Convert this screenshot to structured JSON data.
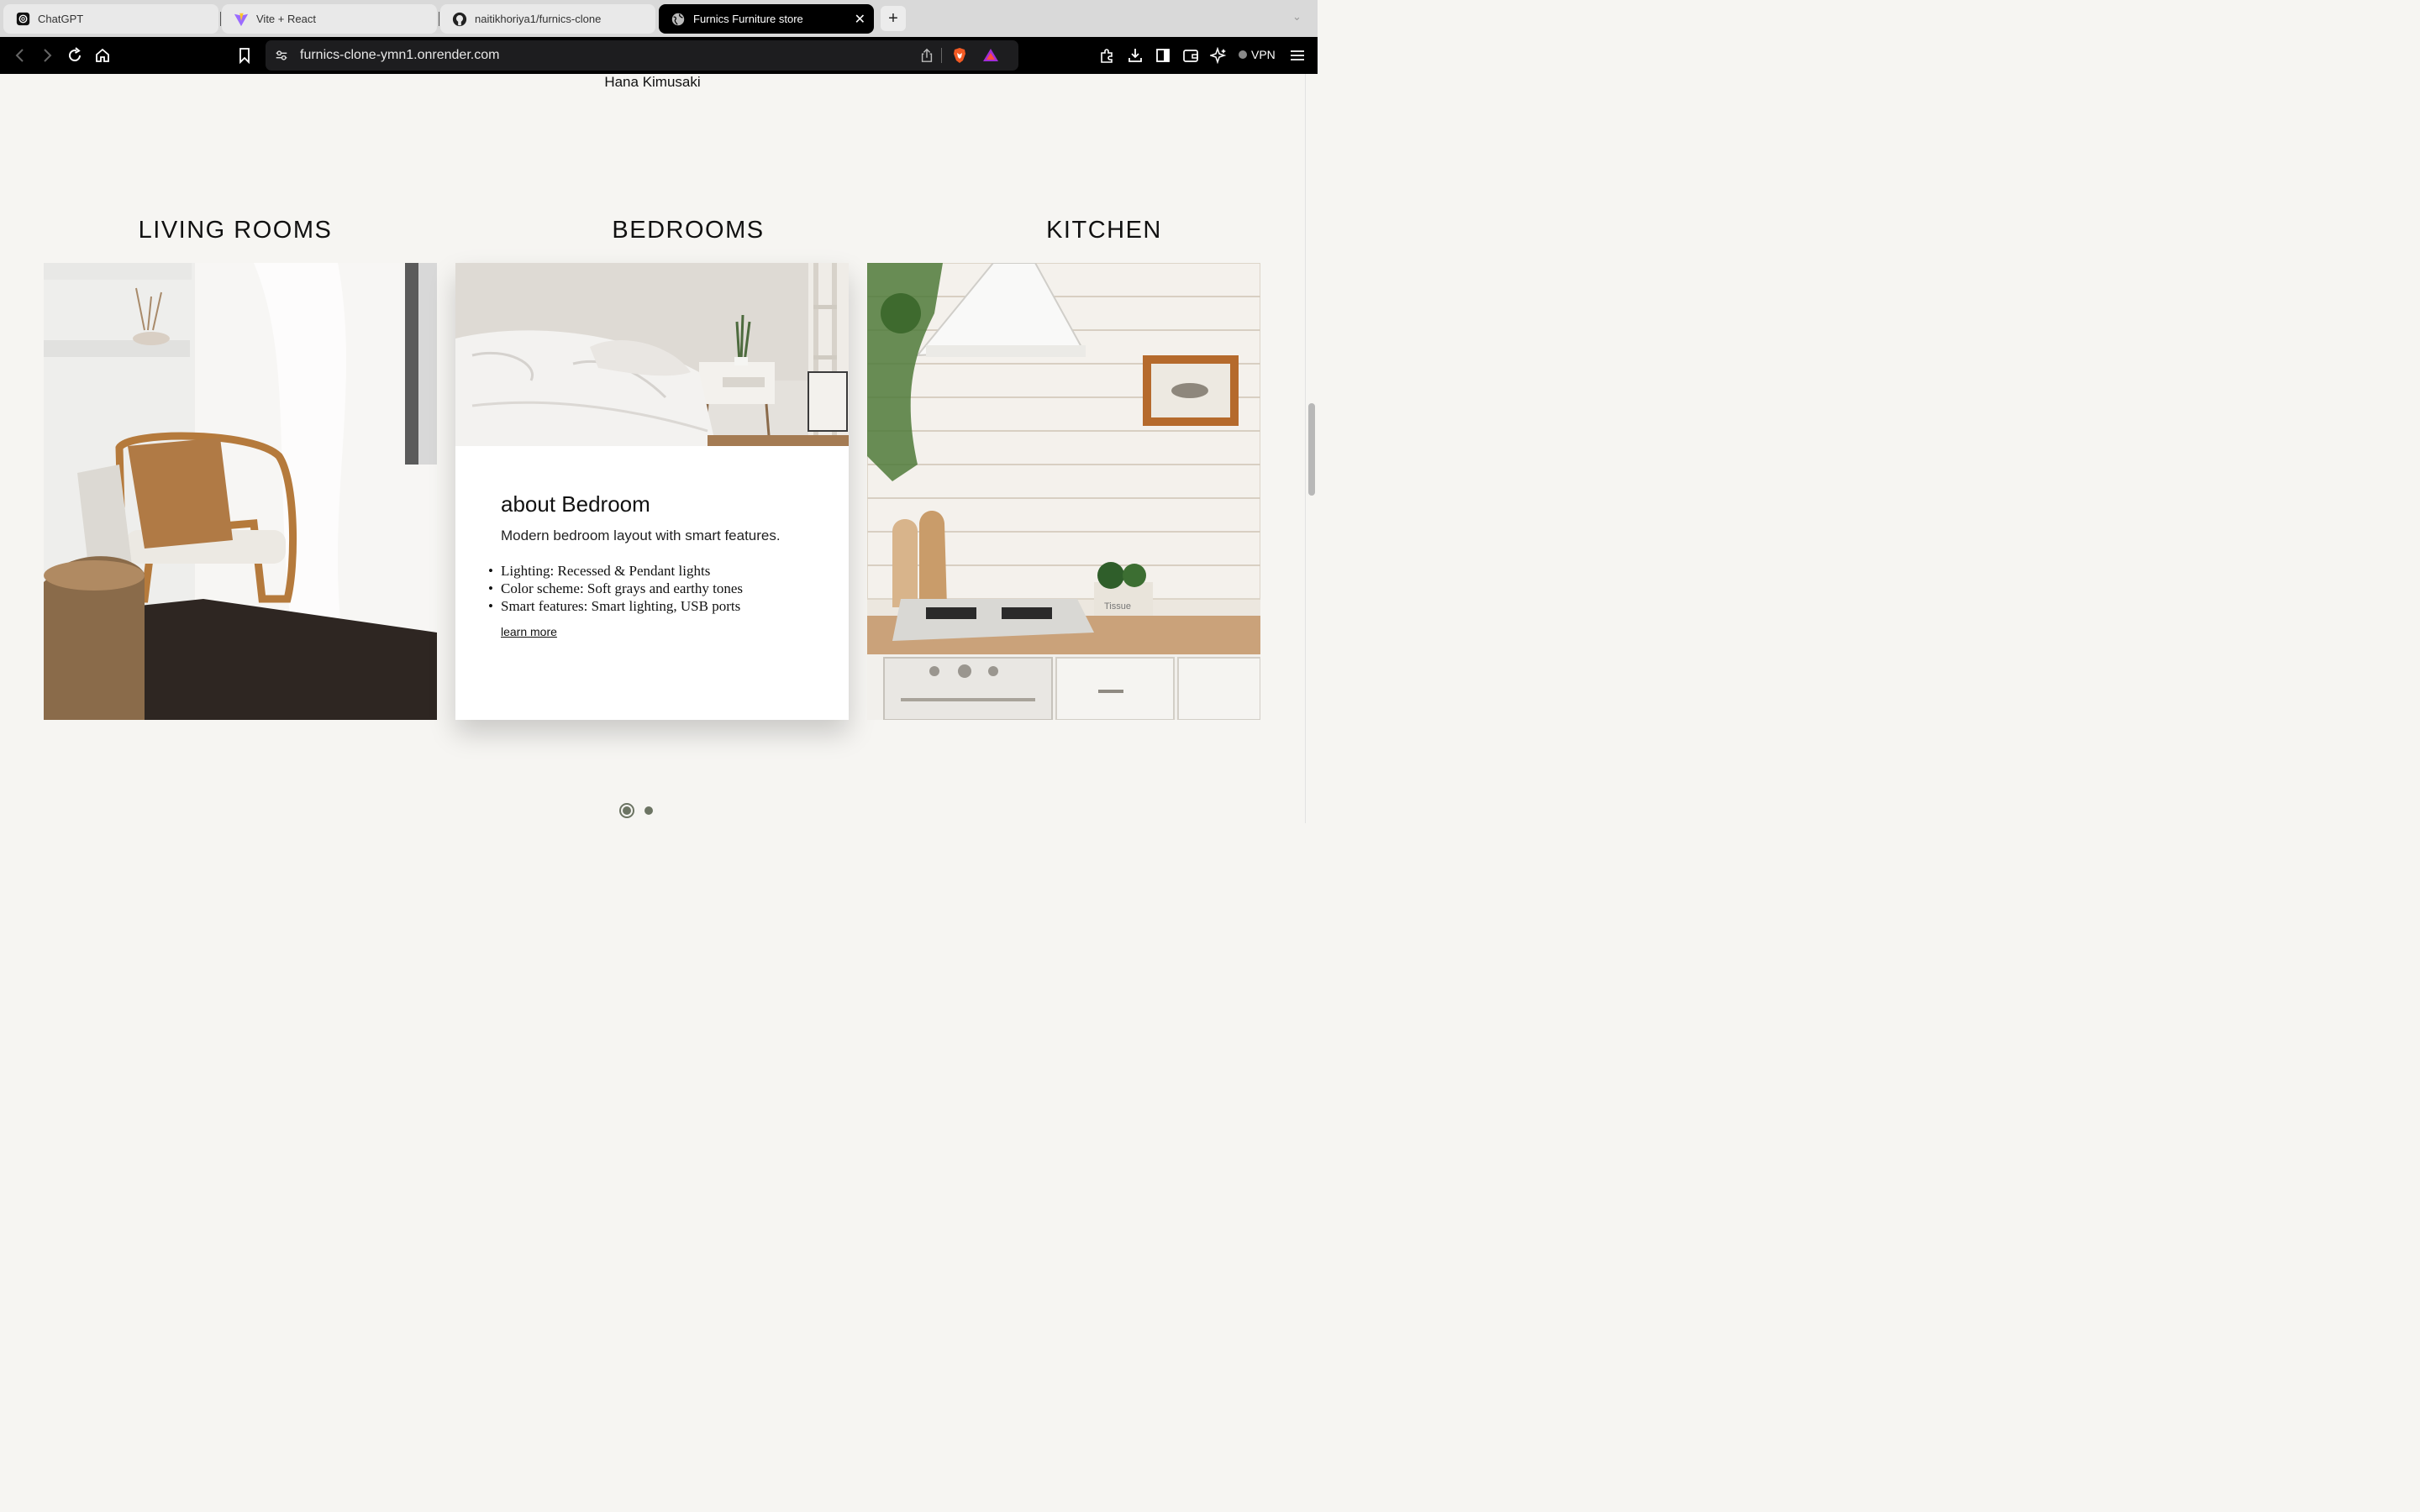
{
  "browser": {
    "tabs": [
      {
        "title": "ChatGPT",
        "icon": "chatgpt-icon"
      },
      {
        "title": "Vite + React",
        "icon": "vite-icon"
      },
      {
        "title": "naitikhoriya1/furnics-clone",
        "icon": "github-icon"
      },
      {
        "title": "Furnics Furniture store",
        "icon": "globe-icon",
        "active": true
      }
    ],
    "url": "furnics-clone-ymn1.onrender.com",
    "vpn_label": "VPN"
  },
  "page": {
    "author_name": "Hana Kimusaki",
    "categories": [
      {
        "title": "LIVING ROOMS"
      },
      {
        "title": "BEDROOMS"
      },
      {
        "title": "KITCHEN"
      }
    ],
    "bedroom_card": {
      "title": "about Bedroom",
      "description": "Modern bedroom layout with smart features.",
      "features": [
        "Lighting: Recessed & Pendant lights",
        "Color scheme: Soft grays and earthy tones",
        "Smart features: Smart lighting, USB ports"
      ],
      "link_label": "learn more"
    },
    "carousel": {
      "active_index": 0,
      "count": 2
    },
    "image_text": {
      "tissue_label": "Tissue"
    }
  },
  "colors": {
    "page_bg": "#f6f5f2",
    "dot": "#6c7463",
    "chrome": "#000000"
  }
}
